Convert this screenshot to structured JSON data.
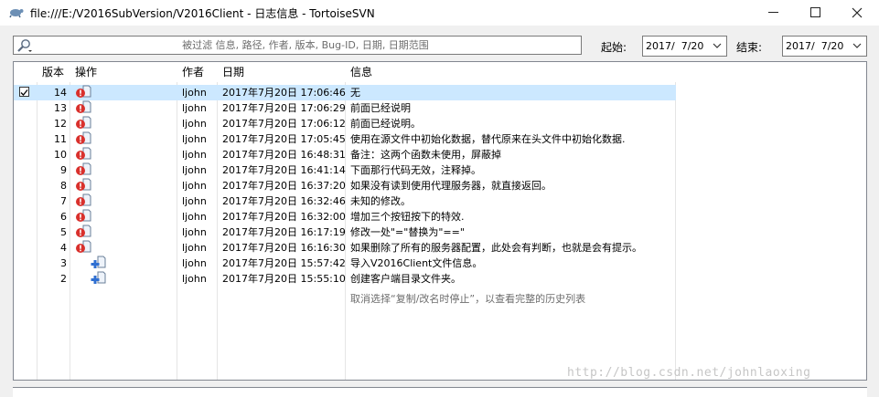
{
  "window": {
    "title": "file:///E:/V2016SubVersion/V2016Client - 日志信息 - TortoiseSVN"
  },
  "filter": {
    "placeholder": "被过滤 信息, 路径, 作者, 版本, Bug-ID, 日期, 日期范围"
  },
  "range": {
    "from_label": "起始:",
    "from_value": "2017/  7/20",
    "to_label": "结束:",
    "to_value": "2017/  7/20"
  },
  "columns": {
    "revision": "版本",
    "actions": "操作",
    "author": "作者",
    "date": "日期",
    "message": "信息"
  },
  "rows": [
    {
      "rev": "14",
      "action": "modified",
      "author": "ljohn",
      "date": "2017年7月20日 17:06:46",
      "msg": "无"
    },
    {
      "rev": "13",
      "action": "modified",
      "author": "ljohn",
      "date": "2017年7月20日 17:06:29",
      "msg": "前面已经说明"
    },
    {
      "rev": "12",
      "action": "modified",
      "author": "ljohn",
      "date": "2017年7月20日 17:06:12",
      "msg": "前面已经说明。"
    },
    {
      "rev": "11",
      "action": "modified",
      "author": "ljohn",
      "date": "2017年7月20日 17:05:45",
      "msg": "使用在源文件中初始化数据，替代原来在头文件中初始化数据."
    },
    {
      "rev": "10",
      "action": "modified",
      "author": "ljohn",
      "date": "2017年7月20日 16:48:31",
      "msg": "备注：这两个函数未使用，屏蔽掉"
    },
    {
      "rev": "9",
      "action": "modified",
      "author": "ljohn",
      "date": "2017年7月20日 16:41:14",
      "msg": "下面那行代码无效，注释掉。"
    },
    {
      "rev": "8",
      "action": "modified",
      "author": "ljohn",
      "date": "2017年7月20日 16:37:20",
      "msg": "如果没有读到使用代理服务器，就直接返回。"
    },
    {
      "rev": "7",
      "action": "modified",
      "author": "ljohn",
      "date": "2017年7月20日 16:32:46",
      "msg": "未知的修改。"
    },
    {
      "rev": "6",
      "action": "modified",
      "author": "ljohn",
      "date": "2017年7月20日 16:32:00",
      "msg": "增加三个按钮按下的特效."
    },
    {
      "rev": "5",
      "action": "modified",
      "author": "ljohn",
      "date": "2017年7月20日 16:17:19",
      "msg": "修改一处\"=\"替换为\"==\""
    },
    {
      "rev": "4",
      "action": "modified",
      "author": "ljohn",
      "date": "2017年7月20日 16:16:30",
      "msg": "如果删除了所有的服务器配置，此处会有判断，也就是会有提示。"
    },
    {
      "rev": "3",
      "action": "added",
      "author": "ljohn",
      "date": "2017年7月20日 15:57:42",
      "msg": "导入V2016Client文件信息。"
    },
    {
      "rev": "2",
      "action": "added",
      "author": "ljohn",
      "date": "2017年7月20日 15:55:10",
      "msg": "创建客户端目录文件夹。"
    }
  ],
  "note": "取消选择“复制/改名时停止”，以查看完整的历史列表",
  "watermark": "http://blog.csdn.net/johnlaoxing",
  "colors": {
    "selected_row": "#cce8ff",
    "modified_badge": "#d9302c",
    "added_badge": "#2f6fd1"
  }
}
